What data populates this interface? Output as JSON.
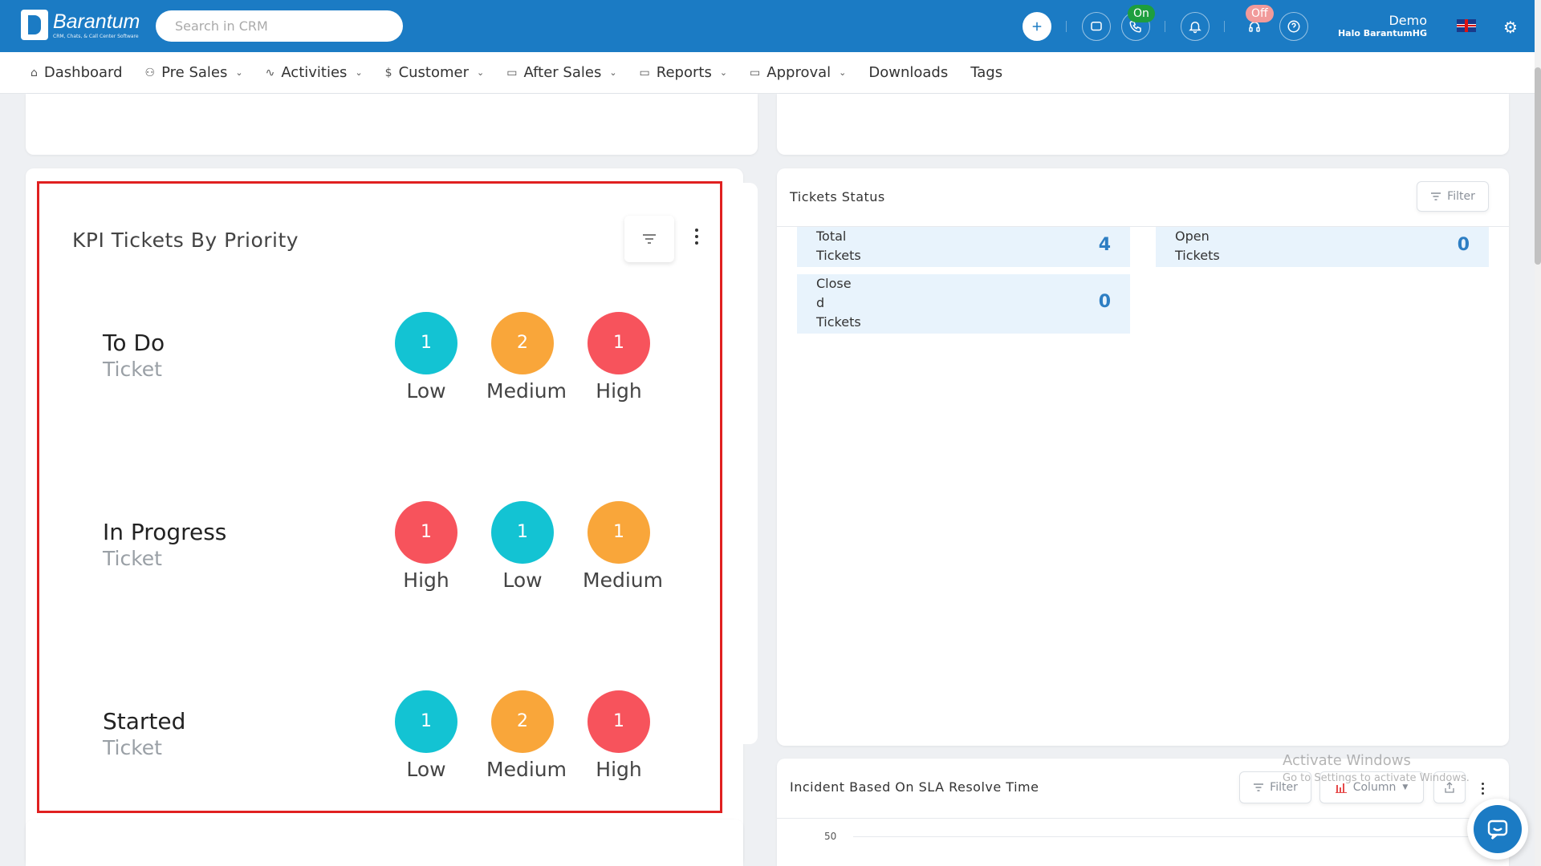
{
  "brand": {
    "name": "Barantum",
    "tagline": "CRM, Chats, & Call Center Software"
  },
  "search": {
    "placeholder": "Search in CRM"
  },
  "topbar": {
    "status_on": "On",
    "status_off": "Off",
    "user_name": "Demo",
    "user_org": "Halo BarantumHG"
  },
  "nav": {
    "items": [
      {
        "label": "Dashboard",
        "icon": "home-icon",
        "dropdown": false
      },
      {
        "label": "Pre Sales",
        "icon": "users-icon",
        "dropdown": true
      },
      {
        "label": "Activities",
        "icon": "activity-icon",
        "dropdown": true
      },
      {
        "label": "Customer",
        "icon": "dollar-icon",
        "dropdown": true
      },
      {
        "label": "After Sales",
        "icon": "folder-icon",
        "dropdown": true
      },
      {
        "label": "Reports",
        "icon": "folder-icon",
        "dropdown": true
      },
      {
        "label": "Approval",
        "icon": "folder-icon",
        "dropdown": true
      },
      {
        "label": "Downloads",
        "icon": "",
        "dropdown": false
      },
      {
        "label": "Tags",
        "icon": "",
        "dropdown": false
      }
    ]
  },
  "kpi": {
    "title": "KPI Tickets By Priority",
    "sub_label": "Ticket",
    "rows": [
      {
        "name": "To Do",
        "items": [
          {
            "count": "1",
            "label": "Low",
            "color": "#13c3d3"
          },
          {
            "count": "2",
            "label": "Medium",
            "color": "#f9a63a"
          },
          {
            "count": "1",
            "label": "High",
            "color": "#f7535c"
          }
        ]
      },
      {
        "name": "In Progress",
        "items": [
          {
            "count": "1",
            "label": "High",
            "color": "#f7535c"
          },
          {
            "count": "1",
            "label": "Low",
            "color": "#13c3d3"
          },
          {
            "count": "1",
            "label": "Medium",
            "color": "#f9a63a"
          }
        ]
      },
      {
        "name": "Started",
        "items": [
          {
            "count": "1",
            "label": "Low",
            "color": "#13c3d3"
          },
          {
            "count": "2",
            "label": "Medium",
            "color": "#f9a63a"
          },
          {
            "count": "1",
            "label": "High",
            "color": "#f7535c"
          }
        ]
      }
    ]
  },
  "tickets_status": {
    "title": "Tickets Status",
    "filter_label": "Filter",
    "stats": [
      {
        "label_lines": [
          "Total",
          "Tickets"
        ],
        "value": "4"
      },
      {
        "label_lines": [
          "Open",
          "Tickets"
        ],
        "value": "0"
      },
      {
        "label_lines": [
          "Close",
          "d",
          "Tickets"
        ],
        "value": "0"
      }
    ]
  },
  "incident": {
    "title": "Incident Based On SLA Resolve Time",
    "filter_label": "Filter",
    "column_label": "Column",
    "y_tick": "50"
  },
  "watermark": {
    "line1": "Activate Windows",
    "line2": "Go to Settings to activate Windows."
  },
  "colors": {
    "brand": "#1b7bc4",
    "low": "#13c3d3",
    "medium": "#f9a63a",
    "high": "#f7535c",
    "highlight_frame": "#e02020"
  }
}
